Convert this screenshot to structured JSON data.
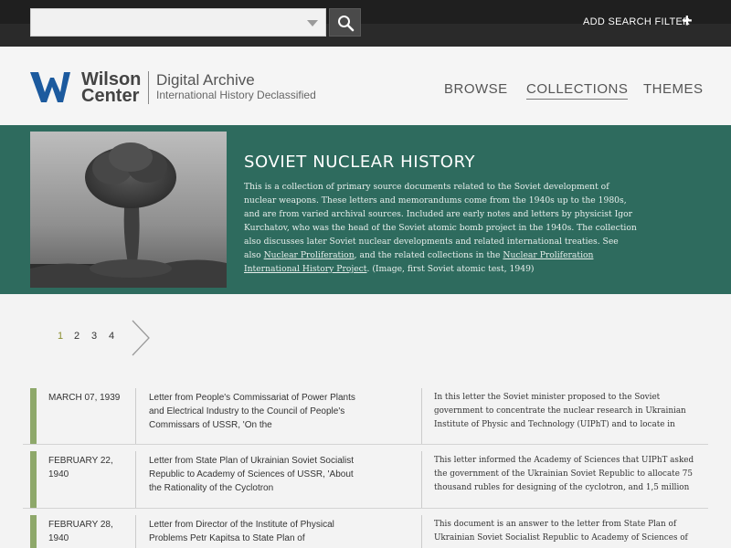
{
  "search": {
    "placeholder": "",
    "add_filter_label": "ADD SEARCH FILTER",
    "add_filter_icon": "plus-icon",
    "search_icon": "search-icon"
  },
  "header": {
    "logo_word1": "Wilson",
    "logo_word2": "Center",
    "site_title": "Digital Archive",
    "site_subtitle": "International History Declassified",
    "nav": [
      "BROWSE",
      "COLLECTIONS",
      "THEMES"
    ],
    "active_nav": "COLLECTIONS"
  },
  "collection": {
    "title": "SOVIET NUCLEAR HISTORY",
    "desc_part1": "This is a collection of primary source documents related to the Soviet development of nuclear weapons. These letters and memorandums come from the 1940s up to the 1980s, and are from varied archival sources. Included are early notes and letters by physicist Igor Kurchatov, who was the head of the Soviet atomic bomb project in the 1940s. The collection also discusses later Soviet nuclear developments and related international treaties. See also ",
    "link1": "Nuclear Proliferation",
    "desc_part2": ", and the related collections in the ",
    "link2": "Nuclear Proliferation International History Project",
    "desc_part3": ". (Image, first Soviet atomic test, 1949)"
  },
  "pagination": {
    "pages": [
      "1",
      "2",
      "3",
      "4"
    ],
    "current": "1",
    "next_icon": "chevron-right-icon"
  },
  "documents": [
    {
      "date": "MARCH 07, 1939",
      "title": "Letter from People's Commissariat of Power Plants and Electrical Industry to the Council of People's Commissars of USSR, 'On the",
      "summary": "In this letter the Soviet minister proposed to the Soviet government to concentrate the nuclear research in Ukrainian Institute of Physic and Technology (UIPhT) and to locate in"
    },
    {
      "date": "FEBRUARY 22, 1940",
      "title": "Letter from State Plan of Ukrainian Soviet Socialist Republic to Academy of Sciences of USSR, 'About the Rationality of the Cyclotron",
      "summary": "This letter informed the Academy of Sciences that UIPhT asked the government of the Ukrainian Soviet Republic to allocate 75 thousand rubles for designing of the cyclotron, and 1,5 million"
    },
    {
      "date": "FEBRUARY 28, 1940",
      "title": "Letter from Director of the Institute of Physical Problems Petr Kapitsa to State Plan of",
      "summary": "This document is an answer to the letter from State Plan of Ukrainian Soviet Socialist Republic to Academy of Sciences of"
    }
  ]
}
